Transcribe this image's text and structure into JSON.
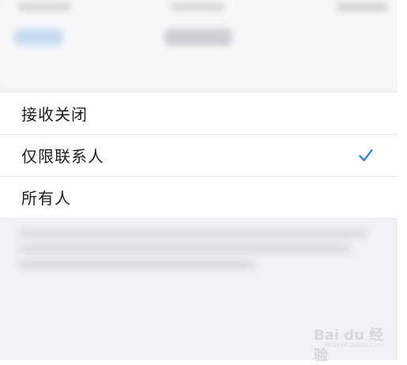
{
  "options": [
    {
      "label": "接收关闭",
      "selected": false
    },
    {
      "label": "仅限联系人",
      "selected": true
    },
    {
      "label": "所有人",
      "selected": false
    }
  ],
  "colors": {
    "accent": "#1a7cf2",
    "background": "#f2f2f6",
    "row": "#ffffff",
    "separator": "#e6e6ea",
    "text": "#1d1d1f"
  },
  "watermark": {
    "brand": "Bai du 经验",
    "sub": "jingyan.baidu.com"
  }
}
